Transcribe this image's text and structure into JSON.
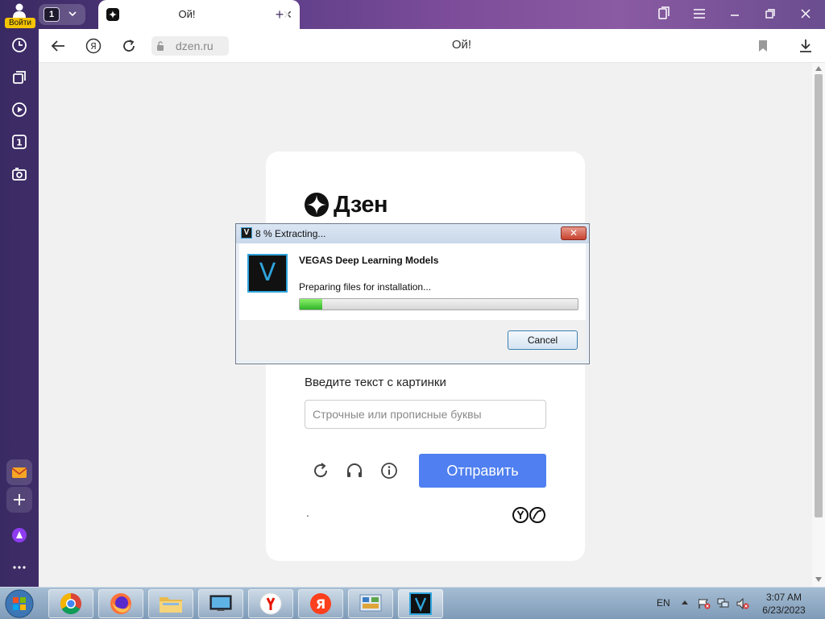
{
  "sidebar": {
    "profile_label": "Войти",
    "tab_counter": "1"
  },
  "tab": {
    "title": "Ой!"
  },
  "toolbar": {
    "host": "dzen.ru",
    "page_title": "Ой!"
  },
  "page": {
    "brand": "Дзен",
    "captcha_label": "Введите текст с картинки",
    "captcha_placeholder": "Строчные или прописные буквы",
    "captcha_value": "",
    "submit_label": "Отправить",
    "footer_dot": "."
  },
  "dialog": {
    "title": "8 % Extracting...",
    "product": "VEGAS Deep Learning Models",
    "status": "Preparing files for installation...",
    "progress_percent": 8,
    "cancel_label": "Cancel",
    "logo_letter": "V",
    "close_glyph": "✕"
  },
  "taskbar": {
    "language": "EN",
    "time": "3:07 AM",
    "date": "6/23/2023",
    "apps": [
      "chrome-icon",
      "firefox-icon",
      "file-explorer-icon",
      "media-center-icon",
      "yandex-browser-icon",
      "yandex-icon",
      "control-panel-icon",
      "vegas-icon"
    ]
  },
  "colors": {
    "submit_button": "#4f7ff0",
    "progress_fill": "#2fb52a",
    "vegas_accent": "#2fa4dc",
    "login_badge": "#f5c400"
  }
}
